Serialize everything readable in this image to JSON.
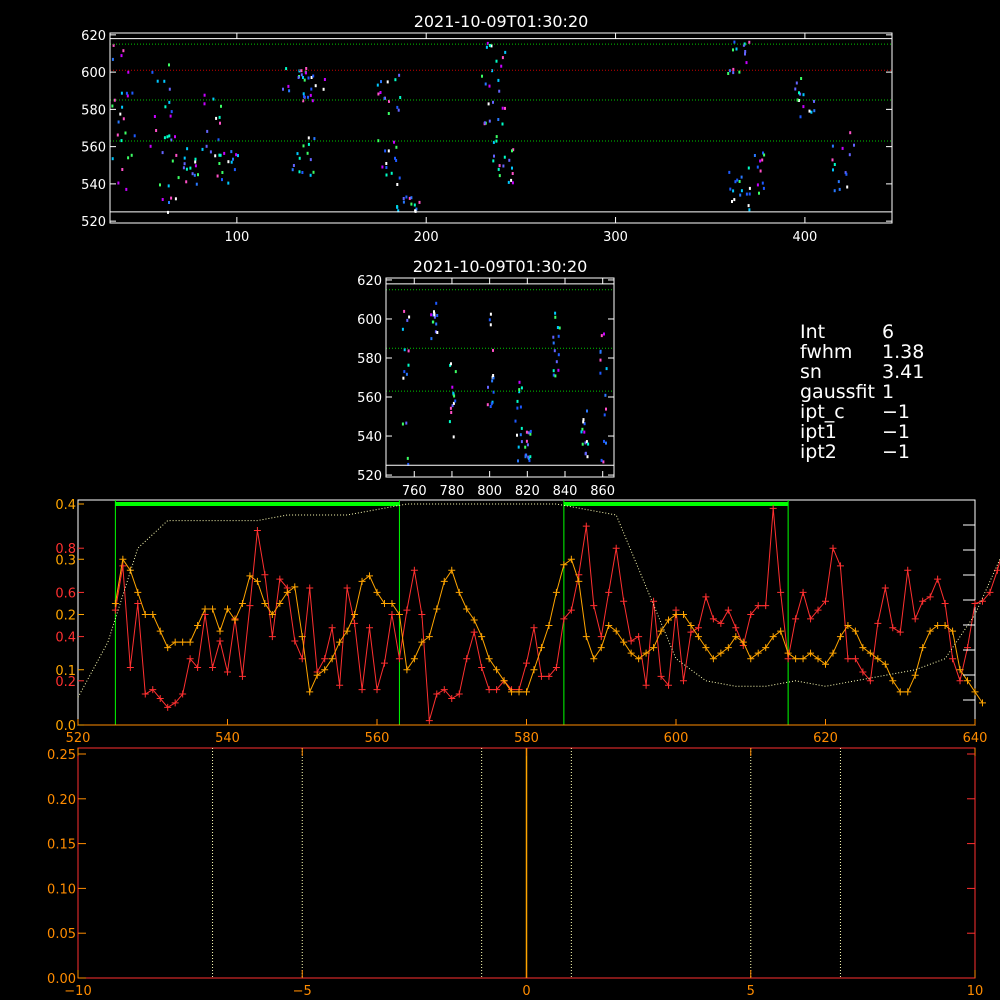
{
  "chart_data": [
    {
      "type": "scatter",
      "id": "top",
      "title": "2021-10-09T01:30:20",
      "xlim": [
        33,
        446
      ],
      "ylim": [
        519,
        621
      ],
      "xticks": [
        100,
        200,
        300,
        400
      ],
      "yticks": [
        520,
        540,
        560,
        580,
        600,
        620
      ],
      "hlines": [
        {
          "y": 618,
          "color": "#ffffff",
          "style": "solid"
        },
        {
          "y": 615,
          "color": "#00c800",
          "style": "dotted"
        },
        {
          "y": 601,
          "color": "#c80000",
          "style": "dotted"
        },
        {
          "y": 585,
          "color": "#00c800",
          "style": "dotted"
        },
        {
          "y": 563,
          "color": "#00c800",
          "style": "dotted"
        },
        {
          "y": 525,
          "color": "#ffffff",
          "style": "solid"
        }
      ],
      "clusters": [
        [
          36,
          620,
          560
        ],
        [
          40,
          615,
          530
        ],
        [
          60,
          605,
          540
        ],
        [
          65,
          585,
          525
        ],
        [
          75,
          560,
          540
        ],
        [
          85,
          590,
          555
        ],
        [
          95,
          560,
          540
        ],
        [
          130,
          606,
          590
        ],
        [
          140,
          600,
          585
        ],
        [
          135,
          570,
          545
        ],
        [
          180,
          600,
          575
        ],
        [
          180,
          565,
          540
        ],
        [
          190,
          535,
          525
        ],
        [
          235,
          618,
          590
        ],
        [
          235,
          585,
          550
        ],
        [
          240,
          565,
          540
        ],
        [
          365,
          620,
          600
        ],
        [
          365,
          550,
          525
        ],
        [
          375,
          560,
          535
        ],
        [
          400,
          600,
          575
        ],
        [
          420,
          570,
          530
        ]
      ]
    },
    {
      "type": "scatter",
      "id": "mid",
      "title": "2021-10-09T01:30:20",
      "xlim": [
        745,
        866
      ],
      "ylim": [
        519,
        621
      ],
      "xticks": [
        760,
        780,
        800,
        820,
        840,
        860
      ],
      "yticks": [
        520,
        540,
        560,
        580,
        600,
        620
      ],
      "hlines": [
        {
          "y": 618,
          "color": "#ffffff",
          "style": "solid"
        },
        {
          "y": 615,
          "color": "#00c800",
          "style": "dotted"
        },
        {
          "y": 585,
          "color": "#00c800",
          "style": "dotted"
        },
        {
          "y": 563,
          "color": "#00c800",
          "style": "dotted"
        },
        {
          "y": 525,
          "color": "#ffffff",
          "style": "solid"
        }
      ],
      "clusters": [
        [
          755,
          605,
          525
        ],
        [
          770,
          610,
          590
        ],
        [
          780,
          580,
          540
        ],
        [
          800,
          610,
          540
        ],
        [
          815,
          570,
          525
        ],
        [
          820,
          545,
          520
        ],
        [
          835,
          605,
          570
        ],
        [
          850,
          555,
          530
        ],
        [
          860,
          600,
          525
        ]
      ]
    },
    {
      "type": "line",
      "id": "profile",
      "xlim": [
        520,
        640
      ],
      "xticks": [
        520,
        540,
        560,
        580,
        600,
        620,
        640
      ],
      "left_axis_red": {
        "ylim": [
          0,
          1.0
        ],
        "ticks": [
          0.2,
          0.4,
          0.6,
          0.8
        ],
        "labels": [
          "0.2",
          "0.4",
          "0.6",
          "0.8"
        ]
      },
      "left_axis_orange": {
        "ylim": [
          0,
          0.4
        ],
        "ticks": [
          0.0,
          0.1,
          0.2,
          0.3,
          0.4
        ],
        "labels": [
          "0.0",
          "0.1",
          "0.2",
          "0.3",
          "0.4"
        ]
      },
      "windows": [
        [
          525,
          563
        ],
        [
          585,
          615
        ]
      ],
      "bar_y": 0.4,
      "series": [
        {
          "color": "#ff3030",
          "axis": "red",
          "step": 1,
          "x0": 525,
          "values": [
            0.52,
            0.72,
            0.26,
            0.55,
            0.14,
            0.16,
            0.12,
            0.08,
            0.1,
            0.14,
            0.3,
            0.26,
            0.5,
            0.26,
            0.38,
            0.24,
            0.48,
            0.22,
            0.54,
            0.88,
            0.68,
            0.4,
            0.66,
            0.62,
            0.38,
            0.3,
            0.62,
            0.24,
            0.3,
            0.44,
            0.18,
            0.62,
            0.46,
            0.16,
            0.44,
            0.16,
            0.28,
            0.5,
            0.3,
            0.52,
            0.7,
            0.5,
            0.02,
            0.14,
            0.16,
            0.12,
            0.14,
            0.3,
            0.42,
            0.26,
            0.16,
            0.16,
            0.2,
            0.16,
            0.16,
            0.28,
            0.44,
            0.22,
            0.22,
            0.26,
            0.48,
            0.52,
            0.68,
            0.9,
            0.54,
            0.4,
            0.6,
            0.8,
            0.56,
            0.38,
            0.4,
            0.18,
            0.56,
            0.22,
            0.18,
            0.52,
            0.2,
            0.42,
            0.44,
            0.58,
            0.48,
            0.46,
            0.52,
            0.44,
            0.36,
            0.5,
            0.54,
            0.54,
            0.98,
            0.6,
            0.3,
            0.48,
            0.6,
            0.48,
            0.52,
            0.56,
            0.8,
            0.72,
            0.3,
            0.3,
            0.24,
            0.2,
            0.46,
            0.62,
            0.44,
            0.42,
            0.7,
            0.48,
            0.56,
            0.58,
            0.66,
            0.55,
            0.3,
            0.2,
            0.35,
            0.55,
            0.56,
            0.6,
            0.7,
            0.82,
            0.8,
            0.62
          ]
        },
        {
          "color": "#ffa500",
          "axis": "orange",
          "step": 1,
          "x0": 525,
          "values": [
            0.22,
            0.3,
            0.28,
            0.24,
            0.2,
            0.2,
            0.17,
            0.14,
            0.15,
            0.15,
            0.15,
            0.18,
            0.21,
            0.21,
            0.17,
            0.21,
            0.19,
            0.22,
            0.27,
            0.26,
            0.22,
            0.2,
            0.22,
            0.24,
            0.25,
            0.16,
            0.06,
            0.09,
            0.1,
            0.12,
            0.15,
            0.17,
            0.2,
            0.26,
            0.27,
            0.24,
            0.22,
            0.22,
            0.2,
            0.1,
            0.12,
            0.15,
            0.16,
            0.21,
            0.26,
            0.28,
            0.24,
            0.21,
            0.19,
            0.16,
            0.12,
            0.1,
            0.08,
            0.06,
            0.06,
            0.06,
            0.1,
            0.14,
            0.18,
            0.24,
            0.29,
            0.3,
            0.26,
            0.16,
            0.12,
            0.14,
            0.18,
            0.17,
            0.15,
            0.13,
            0.12,
            0.13,
            0.14,
            0.17,
            0.19,
            0.2,
            0.2,
            0.18,
            0.16,
            0.14,
            0.12,
            0.13,
            0.14,
            0.16,
            0.15,
            0.12,
            0.13,
            0.14,
            0.16,
            0.17,
            0.13,
            0.12,
            0.12,
            0.13,
            0.12,
            0.11,
            0.13,
            0.16,
            0.18,
            0.17,
            0.14,
            0.13,
            0.12,
            0.11,
            0.08,
            0.06,
            0.06,
            0.09,
            0.14,
            0.17,
            0.18,
            0.18,
            0.17,
            0.1,
            0.08,
            0.06,
            0.04
          ]
        },
        {
          "color": "#ffffb4",
          "axis": "orange",
          "style": "dotted",
          "step": 4,
          "x0": 520,
          "values": [
            0.05,
            0.15,
            0.32,
            0.37,
            0.37,
            0.37,
            0.37,
            0.38,
            0.38,
            0.38,
            0.39,
            0.4,
            0.4,
            0.4,
            0.4,
            0.4,
            0.4,
            0.39,
            0.38,
            0.25,
            0.12,
            0.08,
            0.07,
            0.07,
            0.08,
            0.07,
            0.08,
            0.09,
            0.1,
            0.12,
            0.2,
            0.32,
            0.33,
            0.35,
            0.37,
            0.37,
            0.37,
            0.38,
            0.38,
            0.38,
            0.38,
            0.38,
            0.37,
            0.38,
            0.38,
            0.33,
            0.2,
            0.06,
            0.02,
            0.01,
            0.01,
            0.01,
            0.01,
            0.01,
            0.01,
            0.01,
            0.01,
            0.01,
            0.01,
            0.01,
            0.01
          ]
        }
      ]
    },
    {
      "type": "line",
      "id": "bottom",
      "xlim": [
        -10,
        10
      ],
      "ylim": [
        0,
        0.25
      ],
      "xticks": [
        -10,
        -5,
        0,
        5,
        10
      ],
      "xtick_labels": [
        "−10",
        "−5",
        "0",
        "5",
        "10"
      ],
      "yticks": [
        0,
        0.05,
        0.1,
        0.15,
        0.2,
        0.25
      ],
      "ytick_labels": [
        "0.00",
        "0.05",
        "0.10",
        "0.15",
        "0.20",
        "0.25"
      ],
      "vlines_dotted": [
        -7,
        -5,
        -1,
        1,
        5,
        7
      ],
      "vline_solid": {
        "x": 0,
        "color": "#ffa500"
      }
    }
  ],
  "info": [
    {
      "key": "Int",
      "value": "6"
    },
    {
      "key": "fwhm",
      "value": "1.38"
    },
    {
      "key": "sn",
      "value": "3.41"
    },
    {
      "key": "gaussfit",
      "value": "1"
    },
    {
      "key": "ipt_c",
      "value": "−1"
    },
    {
      "key": "ipt1",
      "value": "−1"
    },
    {
      "key": "ipt2",
      "value": "−1"
    }
  ]
}
